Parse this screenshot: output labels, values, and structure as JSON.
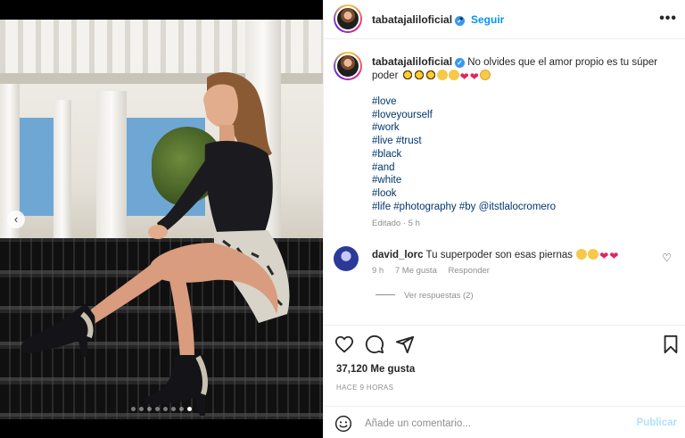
{
  "post": {
    "username": "tabatajaliloficial",
    "follow_label": "Seguir",
    "separator": "•",
    "more_label": "•••"
  },
  "caption": {
    "username": "tabatajaliloficial",
    "text": "No olvides que el amor propio es tu súper poder",
    "hashtags": [
      "#love",
      "#loveyourself",
      "#work",
      "#live #trust",
      "#black",
      "#and",
      "#white",
      "#look"
    ],
    "last_line": {
      "tags": "#life #photography #by",
      "mention": "@itstlalocromero"
    },
    "edited": "Editado · 5 h"
  },
  "comment": {
    "username": "david_lorc",
    "text": "Tu superpoder son esas piernas",
    "time": "9 h",
    "likes": "7 Me gusta",
    "reply_label": "Responder"
  },
  "replies_label": "Ver respuestas (2)",
  "likes_label": "37,120 Me gusta",
  "time_ago": "HACE 9 HORAS",
  "input": {
    "placeholder": "Añade un comentario..."
  },
  "publish_label": "Publicar",
  "carousel": {
    "count": 8,
    "active": 7
  },
  "icons": {
    "like": "heart-icon",
    "comment": "comment-icon",
    "share": "share-icon",
    "save": "bookmark-icon",
    "emoji": "emoji-icon",
    "more": "more-options-icon",
    "prev": "chevron-left-icon"
  },
  "colors": {
    "accent": "#0095f6",
    "verified": "#3897f0",
    "link": "#00376b"
  }
}
